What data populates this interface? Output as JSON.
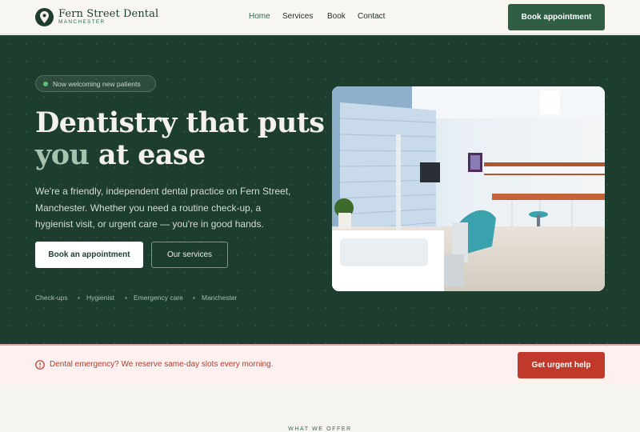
{
  "header": {
    "brand_name": "Fern Street Dental",
    "brand_sub": "MANCHESTER",
    "logo_icon": "map-pin-icon",
    "nav": [
      {
        "label": "Home",
        "active": true
      },
      {
        "label": "Services",
        "active": false
      },
      {
        "label": "Book",
        "active": false
      },
      {
        "label": "Contact",
        "active": false
      }
    ],
    "cta_label": "Book appointment"
  },
  "hero": {
    "badge": "Now welcoming new patients",
    "title_line1": "Dentistry that puts",
    "title_accent": "you",
    "title_rest": " at ease",
    "lede": "We're a friendly, independent dental practice on Fern Street, Manchester. Whether you need a routine check-up, a hygienist visit, or urgent care — you're in good hands.",
    "primary_button": "Book an appointment",
    "secondary_button": "Our services",
    "tags": [
      "Check-ups",
      "Hygienist",
      "Emergency care",
      "Manchester"
    ],
    "image_subject": "dental surgery treatment room"
  },
  "emergency": {
    "icon": "alert-circle-icon",
    "text": "Dental emergency? We reserve same-day slots every morning.",
    "button": "Get urgent help"
  },
  "next_section": {
    "eyebrow": "WHAT WE OFFER"
  },
  "colors": {
    "brand_green": "#1d3d2e",
    "button_green": "#2f5e45",
    "accent_text": "#a7c2ad",
    "urgent_red": "#c0392b",
    "banner_bg": "#fdf0ee"
  }
}
